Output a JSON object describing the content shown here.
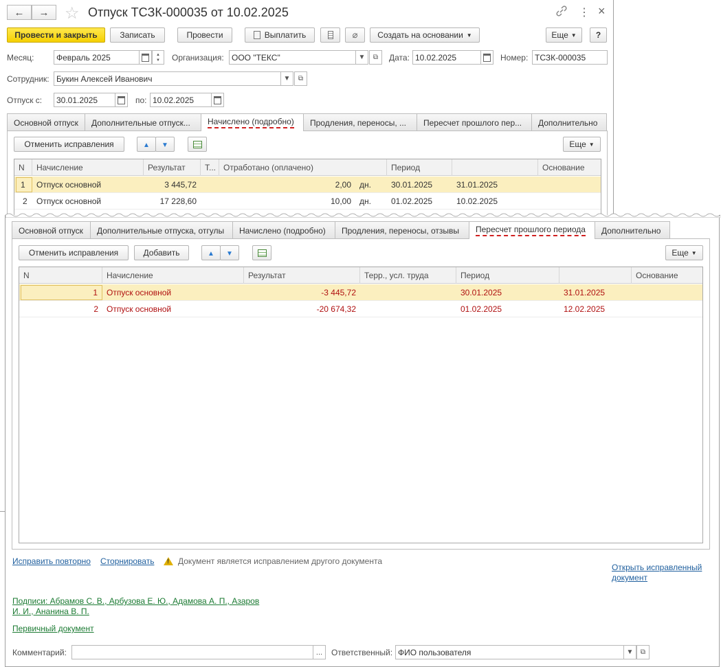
{
  "window": {
    "title": "Отпуск ТСЗК-000035 от 10.02.2025",
    "nav_back": "←",
    "nav_forward": "→",
    "more_dots": "⋮",
    "close": "×"
  },
  "toolbar": {
    "post_close": "Провести и закрыть",
    "save": "Записать",
    "post": "Провести",
    "pay": "Выплатить",
    "create_based": "Создать на основании",
    "more": "Еще",
    "help": "?"
  },
  "form": {
    "month_label": "Месяц:",
    "month_value": "Февраль 2025",
    "org_label": "Организация:",
    "org_value": "ООО \"ТЕКС\"",
    "date_label": "Дата:",
    "date_value": "10.02.2025",
    "number_label": "Номер:",
    "number_value": "ТСЗК-000035",
    "employee_label": "Сотрудник:",
    "employee_value": "Букин Алексей Иванович",
    "vacation_from_label": "Отпуск с:",
    "vacation_from_value": "30.01.2025",
    "vacation_to_label": "по:",
    "vacation_to_value": "10.02.2025"
  },
  "tabs_top": [
    "Основной отпуск",
    "Дополнительные отпуск...",
    "Начислено (подробно)",
    "Продления, переносы, ...",
    "Пересчет прошлого пер...",
    "Дополнительно"
  ],
  "grid_top": {
    "cancel_fixes": "Отменить исправления",
    "more": "Еще",
    "headers": [
      "N",
      "Начисление",
      "Результат",
      "Т...",
      "Отработано (оплачено)",
      "Период",
      "",
      "Основание"
    ],
    "rows": [
      {
        "n": "1",
        "accrual": "Отпуск основной",
        "result": "3 445,72",
        "worked": "2,00",
        "unit": "дн.",
        "from": "30.01.2025",
        "to": "31.01.2025"
      },
      {
        "n": "2",
        "accrual": "Отпуск основной",
        "result": "17 228,60",
        "worked": "10,00",
        "unit": "дн.",
        "from": "01.02.2025",
        "to": "10.02.2025"
      }
    ]
  },
  "tabs_bottom": [
    "Основной отпуск",
    "Дополнительные отпуска, отгулы",
    "Начислено (подробно)",
    "Продления, переносы, отзывы",
    "Пересчет прошлого периода",
    "Дополнительно"
  ],
  "grid_bottom": {
    "cancel_fixes": "Отменить исправления",
    "add": "Добавить",
    "more": "Еще",
    "headers": [
      "N",
      "Начисление",
      "Результат",
      "Терр., усл. труда",
      "Период",
      "",
      "Основание"
    ],
    "rows": [
      {
        "n": "1",
        "accrual": "Отпуск основной",
        "result": "-3 445,72",
        "from": "30.01.2025",
        "to": "31.01.2025"
      },
      {
        "n": "2",
        "accrual": "Отпуск основной",
        "result": "-20 674,32",
        "from": "01.02.2025",
        "to": "12.02.2025"
      }
    ]
  },
  "footer": {
    "fix_again": "Исправить повторно",
    "reverse": "Сторнировать",
    "warning_text": "Документ является исправлением другого документа",
    "open_fixed_line1": "Открыть исправленный",
    "open_fixed_line2": "документ",
    "signatures_line1": "Подписи: Абрамов С. В., Арбузова Е. Ю., Адамова А. П., Азаров",
    "signatures_line2": "И. И., Ананина В. П.",
    "primary_doc": "Первичный документ",
    "comment_label": "Комментарий:",
    "comment_value": "",
    "ellipsis": "...",
    "responsible_label": "Ответственный:",
    "responsible_value": "ФИО пользователя"
  }
}
